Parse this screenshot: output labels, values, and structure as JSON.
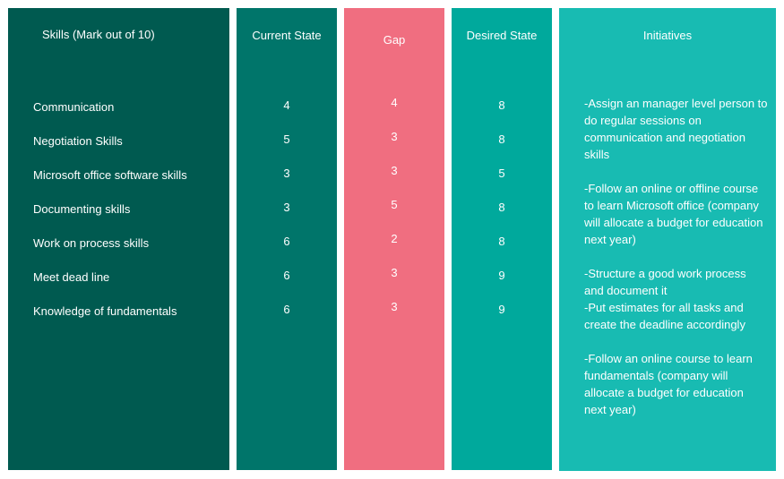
{
  "columns": {
    "skills": "Skills (Mark out of 10)",
    "current": "Current State",
    "gap": "Gap",
    "desired": "Desired State",
    "initiatives": "Initiatives"
  },
  "rows": [
    {
      "skill": "Communication",
      "current": "4",
      "gap": "4",
      "desired": "8"
    },
    {
      "skill": "Negotiation Skills",
      "current": "5",
      "gap": "3",
      "desired": "8"
    },
    {
      "skill": "Microsoft office software skills",
      "current": "3",
      "gap": "3",
      "desired": "5"
    },
    {
      "skill": "Documenting skills",
      "current": "3",
      "gap": "5",
      "desired": "8"
    },
    {
      "skill": "Work on process skills",
      "current": "6",
      "gap": "2",
      "desired": "8"
    },
    {
      "skill": "Meet dead line",
      "current": "6",
      "gap": "3",
      "desired": "9"
    },
    {
      "skill": "Knowledge of fundamentals",
      "current": "6",
      "gap": "3",
      "desired": "9"
    }
  ],
  "initiatives": [
    "-Assign an manager level person to do regular sessions on communication and negotiation skills",
    "-Follow an online or offline course to learn Microsoft office (company will allocate a budget for education next year)",
    "-Structure a good work process and document it",
    "-Put estimates for all tasks and create the deadline accordingly",
    "-Follow an online course to learn fundamentals (company will allocate a budget for education next year)"
  ],
  "colors": {
    "skills": "#005a50",
    "current": "#00756a",
    "gap": "#f06e80",
    "desired": "#00a99c",
    "initiatives": "#18bbb2"
  }
}
